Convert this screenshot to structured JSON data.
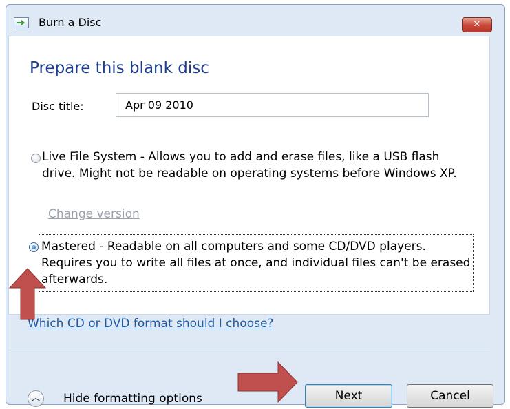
{
  "window": {
    "title": "Burn a Disc",
    "close_label": "✕"
  },
  "content": {
    "heading": "Prepare this blank disc",
    "disc_title": {
      "label": "Disc title:",
      "value": "Apr 09 2010"
    },
    "options": [
      {
        "text": "Live File System - Allows you to add and erase files, like a USB flash drive. Might not be readable on operating systems before Windows XP.",
        "selected": false,
        "link": "Change version"
      },
      {
        "text": "Mastered - Readable on all computers and some CD/DVD players. Requires you to write all files at once, and individual files can't be erased afterwards.",
        "selected": true
      }
    ],
    "help_link": "Which CD or DVD format should I choose?"
  },
  "footer": {
    "toggle_label": "Hide formatting options",
    "next_label": "Next",
    "cancel_label": "Cancel"
  },
  "annotations": {
    "arrow_color": "#c0504d"
  }
}
